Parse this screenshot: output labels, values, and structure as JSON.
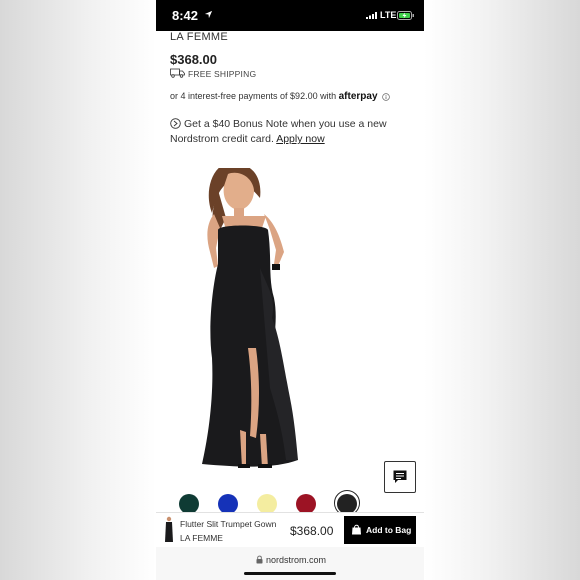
{
  "status_bar": {
    "time": "8:42",
    "network": "LTE"
  },
  "product": {
    "brand": "LA FEMME",
    "price": "$368.00",
    "shipping": "FREE SHIPPING",
    "pay_prefix": "or 4 interest-free payments of $92.00 with",
    "pay_provider": "afterpay",
    "bonus_line1": "Get a $40 Bonus Note when you use a new",
    "bonus_line2": "Nordstrom credit card.",
    "apply_link": "Apply now"
  },
  "swatches": [
    {
      "name": "dark-green",
      "color": "#0f3b34"
    },
    {
      "name": "blue",
      "color": "#1532b8"
    },
    {
      "name": "yellow",
      "color": "#f4eda0"
    },
    {
      "name": "red",
      "color": "#9c1324"
    },
    {
      "name": "black",
      "color": "#222222",
      "selected": true
    }
  ],
  "bottom_bar": {
    "title": "Flutter Slit Trumpet Gown",
    "brand": "LA FEMME",
    "price": "$368.00",
    "cta": "Add to Bag"
  },
  "browser": {
    "url": "nordstrom.com"
  },
  "icons": {
    "location": "location-arrow-icon",
    "signal": "signal-bars-icon",
    "battery": "battery-charging-icon",
    "shipping": "truck-icon",
    "info": "info-icon",
    "bonus": "nordstrom-note-icon",
    "chat": "chat-icon",
    "bag": "shopping-bag-icon",
    "lock": "lock-icon"
  }
}
